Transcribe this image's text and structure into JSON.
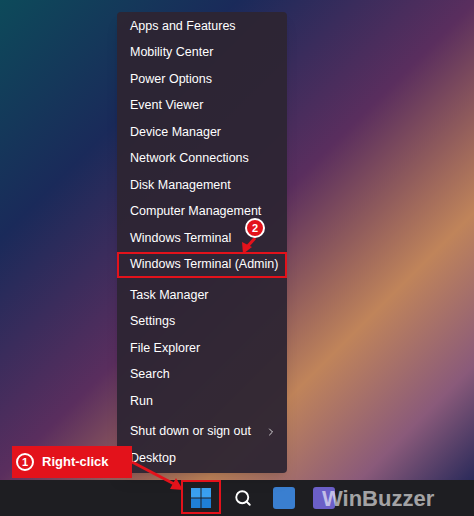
{
  "menu": {
    "items": [
      {
        "kind": "item",
        "label": "Apps and Features",
        "highlighted": false,
        "submenu": false
      },
      {
        "kind": "item",
        "label": "Mobility Center",
        "highlighted": false,
        "submenu": false
      },
      {
        "kind": "item",
        "label": "Power Options",
        "highlighted": false,
        "submenu": false
      },
      {
        "kind": "item",
        "label": "Event Viewer",
        "highlighted": false,
        "submenu": false
      },
      {
        "kind": "item",
        "label": "Device Manager",
        "highlighted": false,
        "submenu": false
      },
      {
        "kind": "item",
        "label": "Network Connections",
        "highlighted": false,
        "submenu": false
      },
      {
        "kind": "item",
        "label": "Disk Management",
        "highlighted": false,
        "submenu": false
      },
      {
        "kind": "item",
        "label": "Computer Management",
        "highlighted": false,
        "submenu": false
      },
      {
        "kind": "item",
        "label": "Windows Terminal",
        "highlighted": false,
        "submenu": false
      },
      {
        "kind": "item",
        "label": "Windows Terminal (Admin)",
        "highlighted": true,
        "submenu": false
      },
      {
        "kind": "separator"
      },
      {
        "kind": "item",
        "label": "Task Manager",
        "highlighted": false,
        "submenu": false
      },
      {
        "kind": "item",
        "label": "Settings",
        "highlighted": false,
        "submenu": false
      },
      {
        "kind": "item",
        "label": "File Explorer",
        "highlighted": false,
        "submenu": false
      },
      {
        "kind": "item",
        "label": "Search",
        "highlighted": false,
        "submenu": false
      },
      {
        "kind": "item",
        "label": "Run",
        "highlighted": false,
        "submenu": false
      },
      {
        "kind": "separator"
      },
      {
        "kind": "item",
        "label": "Shut down or sign out",
        "highlighted": false,
        "submenu": true
      },
      {
        "kind": "item",
        "label": "Desktop",
        "highlighted": false,
        "submenu": false
      }
    ]
  },
  "annotations": [
    {
      "number": "1",
      "label": "Right-click"
    },
    {
      "number": "2"
    }
  ],
  "watermark": "WinBuzzer"
}
